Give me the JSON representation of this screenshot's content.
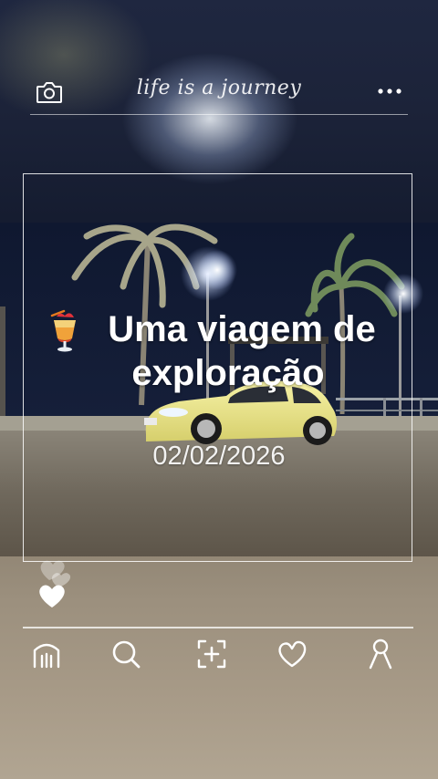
{
  "header": {
    "title": "life is a journey",
    "camera_icon": "camera-icon",
    "more_icon": "more-dots-icon"
  },
  "post": {
    "title_line1": "Uma viagem de",
    "title_line2": "exploração",
    "emoji_icon": "tropical-drink-icon",
    "date": "02/02/2026"
  },
  "reactions": {
    "icon": "hearts-icon"
  },
  "bottom_nav": {
    "items": [
      {
        "icon": "home-icon"
      },
      {
        "icon": "search-icon"
      },
      {
        "icon": "add-post-icon"
      },
      {
        "icon": "heart-icon"
      },
      {
        "icon": "profile-icon"
      }
    ]
  },
  "colors": {
    "sky": "#1c2339",
    "sand": "#a79a87",
    "car": "#f1ec8a",
    "line": "#ffffff"
  }
}
